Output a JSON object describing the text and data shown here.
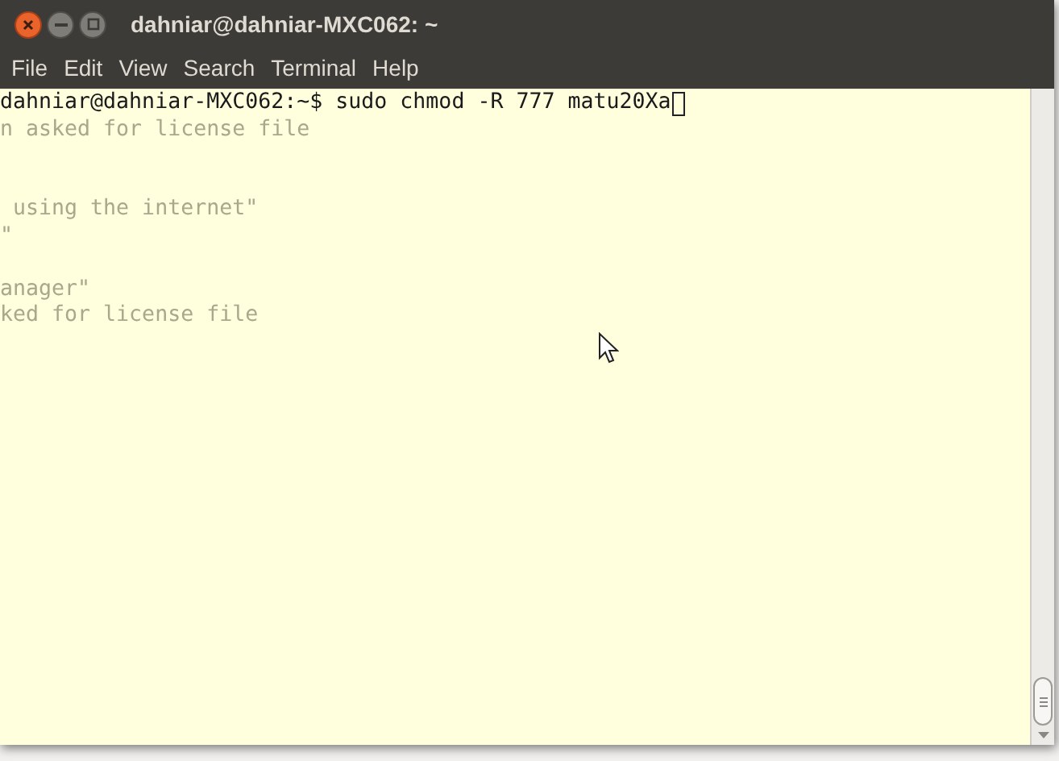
{
  "window": {
    "title": "dahniar@dahniar-MXC062: ~"
  },
  "menu": [
    {
      "label": "File"
    },
    {
      "label": "Edit"
    },
    {
      "label": "View"
    },
    {
      "label": "Search"
    },
    {
      "label": "Terminal"
    },
    {
      "label": "Help"
    }
  ],
  "terminal": {
    "lines": [
      {
        "kind": "prompt",
        "text": "dahniar@dahniar-MXC062:~$ sudo chmod -R 777 matu20Xa"
      },
      {
        "kind": "faded",
        "text": "n asked for license file"
      },
      {
        "kind": "blank"
      },
      {
        "kind": "blank"
      },
      {
        "kind": "faded",
        "text": " using the internet\""
      },
      {
        "kind": "faded",
        "text": "\""
      },
      {
        "kind": "blank"
      },
      {
        "kind": "faded",
        "text": "anager\""
      },
      {
        "kind": "faded",
        "text": "ked for license file"
      }
    ]
  }
}
